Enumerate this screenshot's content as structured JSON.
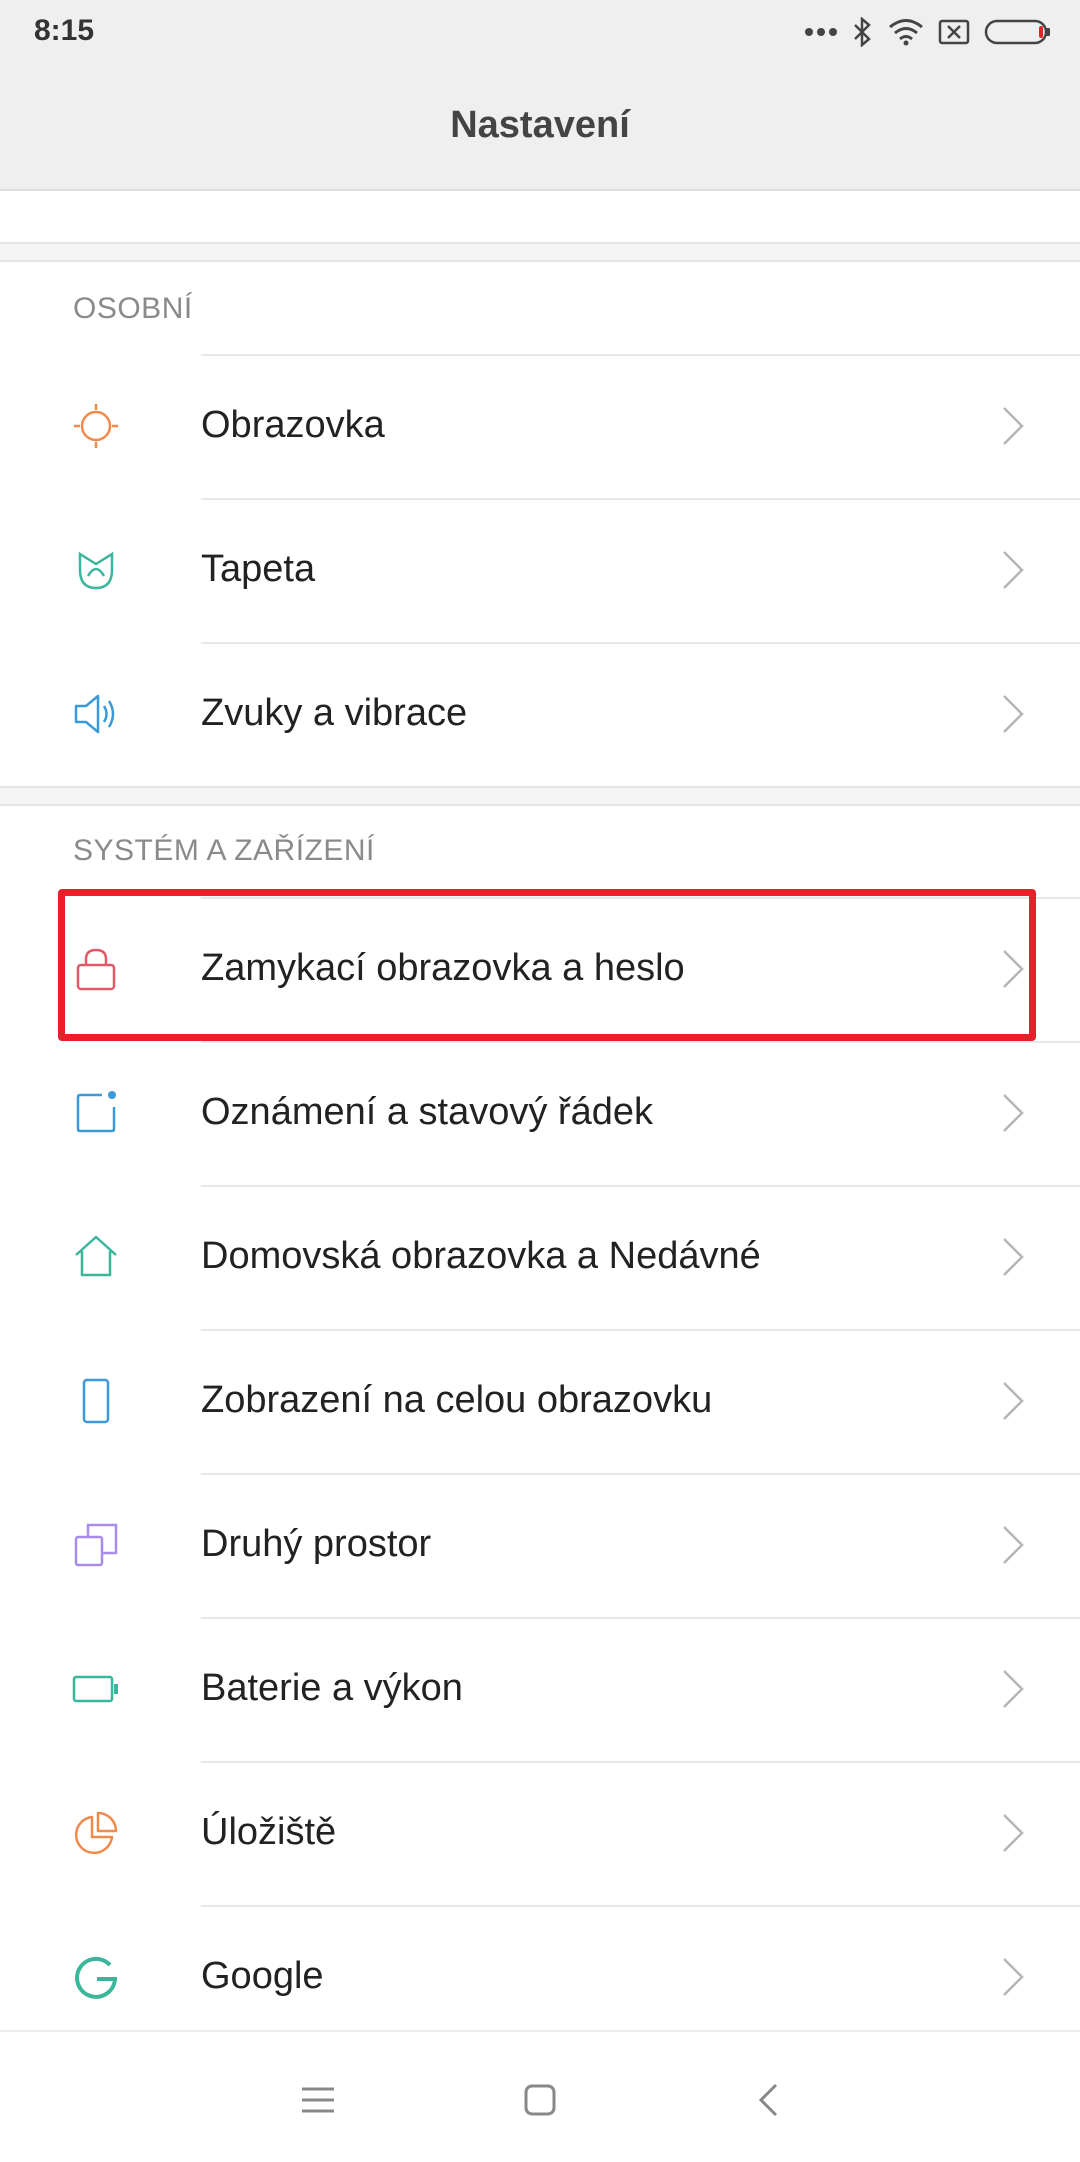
{
  "status_bar": {
    "time": "8:15",
    "icons": [
      "more-dots-icon",
      "bluetooth-icon",
      "wifi-icon",
      "sim-none-icon",
      "battery-icon"
    ],
    "battery_accent": "#e8202a"
  },
  "header": {
    "title": "Nastavení"
  },
  "sections": {
    "personal": {
      "title": "OSOBNÍ",
      "items": [
        {
          "label": "Obrazovka",
          "icon": "brightness-icon",
          "color": "#f08a4b"
        },
        {
          "label": "Tapeta",
          "icon": "tulip-icon",
          "color": "#3bb59b"
        },
        {
          "label": "Zvuky a vibrace",
          "icon": "speaker-icon",
          "color": "#3a9ad9"
        }
      ]
    },
    "system": {
      "title": "SYSTÉM A ZAŘÍZENÍ",
      "items": [
        {
          "label": "Zamykací obrazovka a heslo",
          "icon": "lock-icon",
          "color": "#e05a6a"
        },
        {
          "label": "Oznámení a stavový řádek",
          "icon": "notification-icon",
          "color": "#3a9ad9"
        },
        {
          "label": "Domovská obrazovka a Nedávné",
          "icon": "home-icon",
          "color": "#3bb59b"
        },
        {
          "label": "Zobrazení na celou obrazovku",
          "icon": "phone-icon",
          "color": "#3a9ad9"
        },
        {
          "label": "Druhý prostor",
          "icon": "dual-space-icon",
          "color": "#a98bea"
        },
        {
          "label": "Baterie a výkon",
          "icon": "battery-icon",
          "color": "#3bb59b"
        },
        {
          "label": "Úložiště",
          "icon": "pie-chart-icon",
          "color": "#f08a4b"
        },
        {
          "label": "Google",
          "icon": "google-icon",
          "color": "#3bb59b"
        }
      ]
    }
  },
  "nav_bar": {
    "icons": [
      "menu-icon",
      "home-square-icon",
      "back-icon"
    ]
  },
  "highlight_color": "#e8202a"
}
